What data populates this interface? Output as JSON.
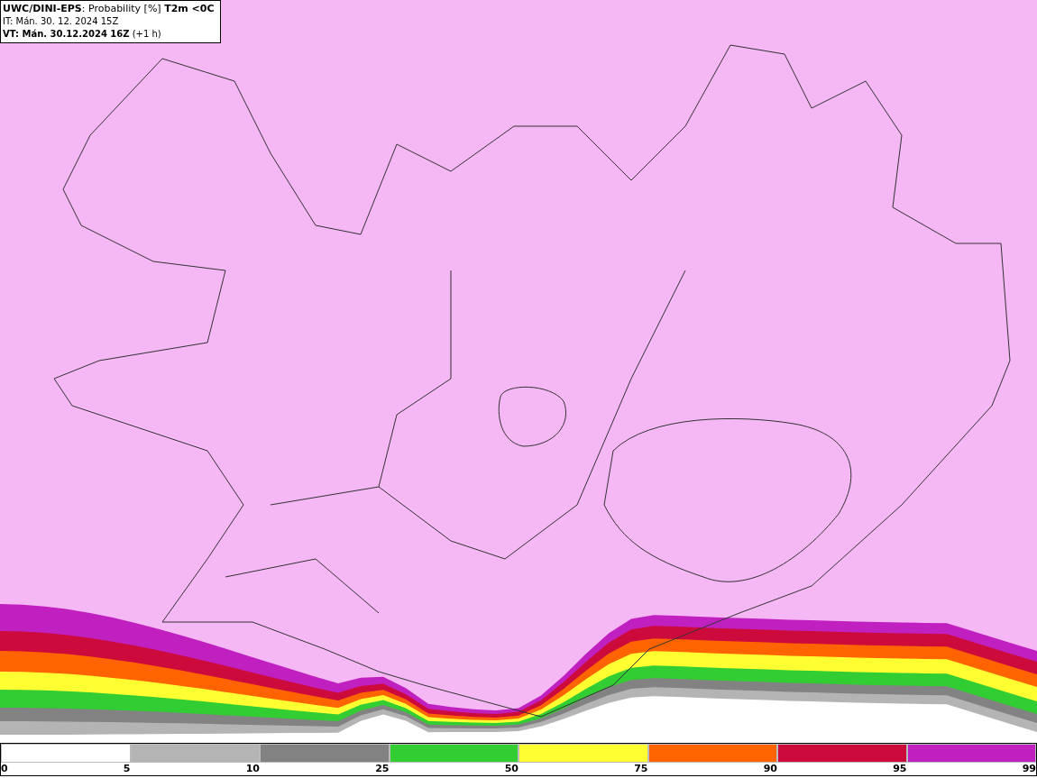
{
  "header": {
    "lines": [
      "**UWC/DINI-EPS**: Probability [%] **T2m <0C**",
      "IT: Mán. 30. 12. 2024 15Z",
      "**VT: Mán. 30.12.2024 16Z** (+1 h)"
    ]
  },
  "legend": {
    "segments": [
      {
        "color": "#ffffff"
      },
      {
        "color": "#b4b4b4"
      },
      {
        "color": "#828282"
      },
      {
        "color": "#32cd32"
      },
      {
        "color": "#ffff32"
      },
      {
        "color": "#ff6400"
      },
      {
        "color": "#cd0a3c"
      },
      {
        "color": "#c020c0"
      }
    ],
    "labels": [
      "0",
      "5",
      "10",
      "25",
      "50",
      "75",
      "90",
      "95",
      "99"
    ]
  }
}
